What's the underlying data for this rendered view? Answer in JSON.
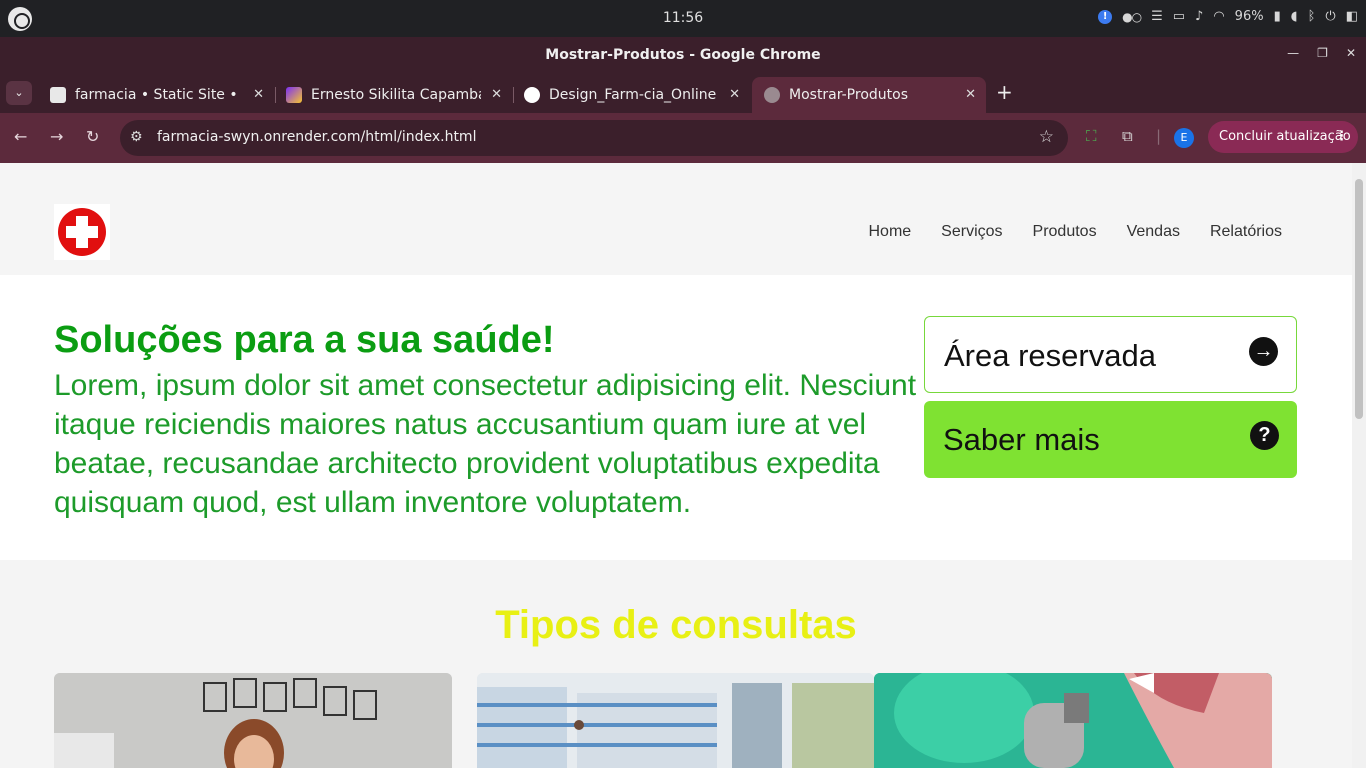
{
  "os": {
    "time": "11:56",
    "battery": "96%"
  },
  "window": {
    "title": "Mostrar-Produtos - Google Chrome"
  },
  "tabs": [
    {
      "label": "farmacia  •  Static Site  •"
    },
    {
      "label": "Ernesto Sikilita Capamba"
    },
    {
      "label": "Design_Farm-cia_Online"
    },
    {
      "label": "Mostrar-Produtos"
    }
  ],
  "toolbar": {
    "url": "farmacia-swyn.onrender.com/html/index.html",
    "profile_initial": "E",
    "update_label": "Concluir atualização"
  },
  "site": {
    "nav": [
      "Home",
      "Serviços",
      "Produtos",
      "Vendas",
      "Relatórios"
    ],
    "hero": {
      "title": "Soluções para a sua saúde!",
      "text": "Lorem, ipsum dolor sit amet consectetur adipisicing elit. Nesciunt itaque reiciendis maiores natus accusantium quam iure at vel beatae, recusandae architecto provident voluptatibus expedita quisquam quod, est ullam inventore voluptatem.",
      "reserved_label": "Área reservada",
      "more_label": "Saber mais"
    },
    "consult_title": "Tipos de consultas"
  },
  "colors": {
    "hero_title": "#0b9d12",
    "accent_green": "#7fe232",
    "consult_title": "#e8f014",
    "logo_red": "#e10f0f"
  }
}
